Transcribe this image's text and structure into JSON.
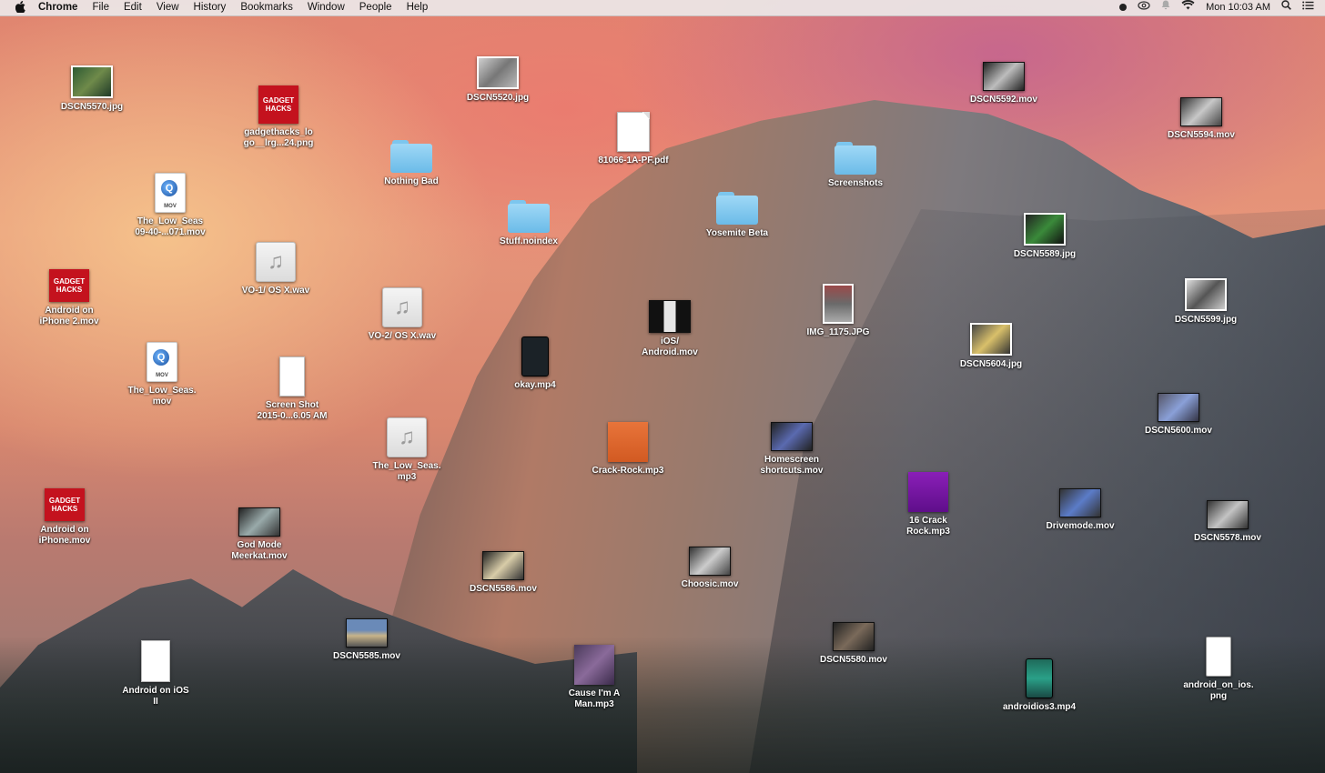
{
  "menubar": {
    "apple_symbol": "",
    "app_name": "Chrome",
    "menus": [
      "File",
      "Edit",
      "View",
      "History",
      "Bookmarks",
      "Window",
      "People",
      "Help"
    ],
    "status": {
      "clock": "Mon 10:03 AM"
    }
  },
  "desktop": {
    "items": {
      "dscn5570": "DSCN5570.jpg",
      "gadgethacks_logo": "gadgethacks_lo\ngo__lrg...24.png",
      "dscn5520": "DSCN5520.jpg",
      "pdf_81066": "81066-1A-PF.pdf",
      "dscn5592": "DSCN5592.mov",
      "dscn5594": "DSCN5594.mov",
      "nothing_bad": "Nothing Bad",
      "screenshots": "Screenshots",
      "the_low_seas_long": "The_Low_Seas\n09-40-...071.mov",
      "stuff_noindex": "Stuff.noindex",
      "yosemite_beta": "Yosemite Beta",
      "dscn5589": "DSCN5589.jpg",
      "vo1": "VO-1/ OS X.wav",
      "android_iphone2": "Android on\niPhone 2.mov",
      "vo2": "VO-2/ OS X.wav",
      "ios_android": "iOS/\nAndroid.mov",
      "img1175": "IMG_1175.JPG",
      "dscn5599": "DSCN5599.jpg",
      "the_low_seas_mov": "The_Low_Seas.\nmov",
      "screen_shot": "Screen Shot\n2015-0...6.05 AM",
      "okay_mp4": "okay.mp4",
      "dscn5604": "DSCN5604.jpg",
      "dscn5600": "DSCN5600.mov",
      "the_low_seas_mp3": "The_Low_Seas.\nmp3",
      "crack_rock": "Crack-Rock.mp3",
      "homescreen": "Homescreen\nshortcuts.mov",
      "crack_rock_16": "16 Crack\nRock.mp3",
      "drivemode": "Drivemode.mov",
      "android_iphone": "Android on\niPhone.mov",
      "god_mode": "God Mode\nMeerkat.mov",
      "dscn5578": "DSCN5578.mov",
      "dscn5586": "DSCN5586.mov",
      "choosic": "Choosic.mov",
      "dscn5585": "DSCN5585.mov",
      "android_ios_ii": "Android on iOS\nII",
      "cause_im_a_man": "Cause I'm A\nMan.mp3",
      "dscn5580": "DSCN5580.mov",
      "androidios3": "androidios3.mp4",
      "android_on_ios_png": "android_on_ios.\npng"
    },
    "gadget_hacks_logo_text": "GADGET\nHACKS"
  }
}
